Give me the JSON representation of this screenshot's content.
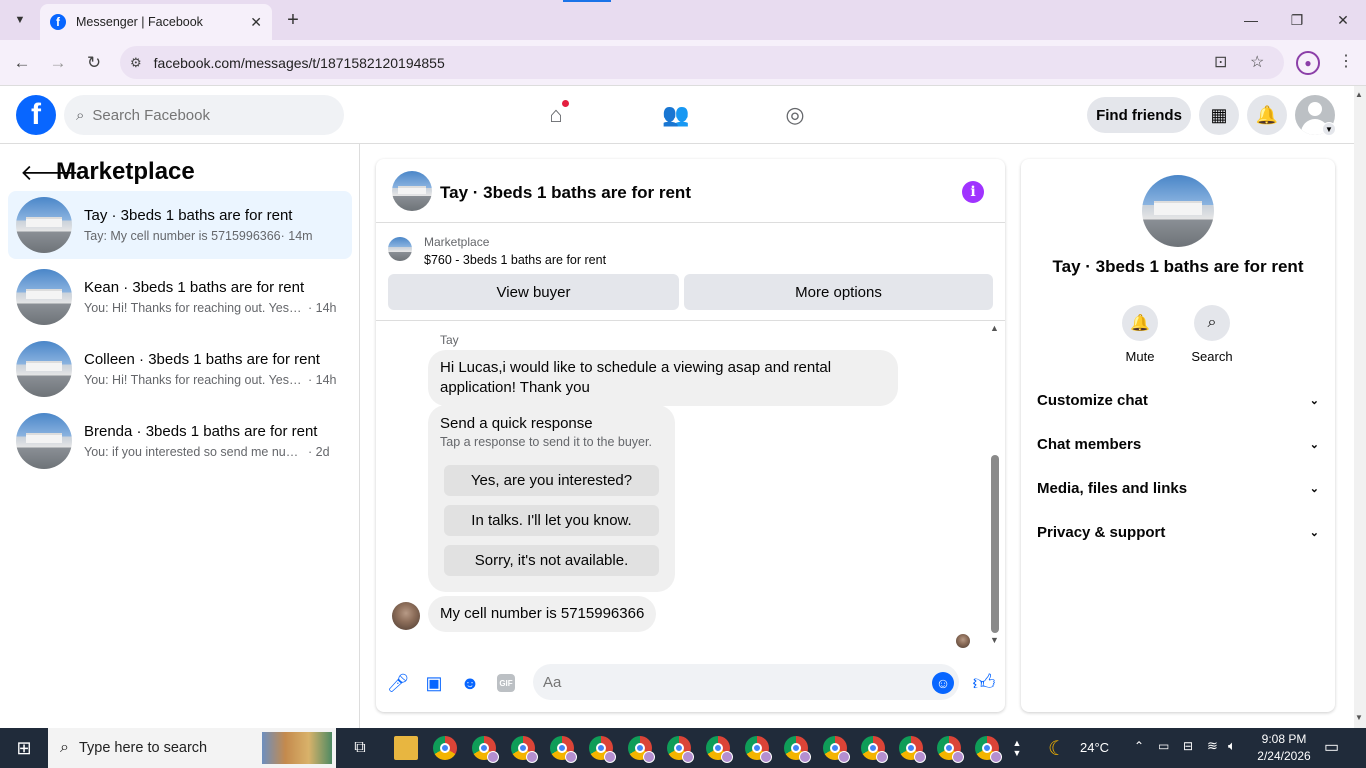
{
  "browser": {
    "tab_title": "Messenger | Facebook",
    "url": "facebook.com/messages/t/1871582120194855"
  },
  "fb": {
    "search_placeholder": "Search Facebook",
    "find_friends": "Find friends"
  },
  "sidebar": {
    "title": "Marketplace",
    "conversations": [
      {
        "name": "Tay · 3beds 1 baths are for rent",
        "preview": "Tay: My cell number is 5715996366",
        "time": "· 14m",
        "active": true
      },
      {
        "name": "Kean · 3beds 1 baths are for rent",
        "preview": "You: Hi! Thanks for reaching out. Yes, the property is available.",
        "time": "· 14h"
      },
      {
        "name": "Colleen · 3beds 1 baths are for rent",
        "preview": "You: Hi! Thanks for reaching out. Yes, the property is available.",
        "time": "· 14h"
      },
      {
        "name": "Brenda · 3beds 1 baths are for rent",
        "preview": "You: if you interested so send me number",
        "time": "· 2d"
      }
    ]
  },
  "chat": {
    "title": "Tay · 3beds 1 baths are for rent",
    "listing_source": "Marketplace",
    "listing_price": "$760 - 3beds 1 baths are for rent",
    "view_buyer": "View buyer",
    "more_options": "More options",
    "sender_name": "Tay",
    "message_1": "Hi Lucas,i would like to schedule a viewing asap and rental application! Thank you",
    "quick_title": "Send a quick response",
    "quick_subtitle": "Tap a response to send it to the buyer.",
    "quick_replies": [
      "Yes, are you interested?",
      "In talks. I'll let you know.",
      "Sorry, it's not available."
    ],
    "message_2": "My cell number is 5715996366",
    "input_placeholder": "Aa",
    "gif_label": "GIF"
  },
  "info": {
    "name": "Tay · 3beds 1 baths are for rent",
    "mute": "Mute",
    "search": "Search",
    "sections": [
      "Customize chat",
      "Chat members",
      "Media, files and links",
      "Privacy & support"
    ]
  },
  "taskbar": {
    "search_placeholder": "Type here to search",
    "weather": "24°C",
    "time": "9:08 PM",
    "date": "2/24/2026"
  },
  "colors": {
    "fb_blue": "#0866ff",
    "active_row": "#ebf5ff",
    "info_purple": "#a033ff",
    "notif_red": "#e41e3f"
  }
}
